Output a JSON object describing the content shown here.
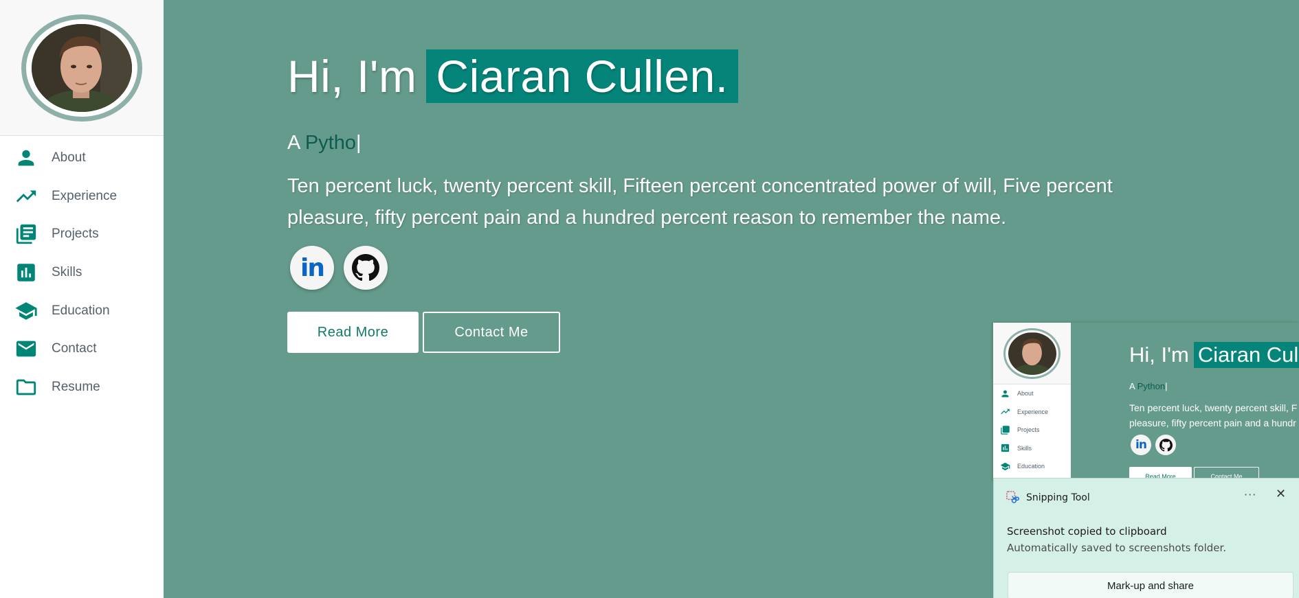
{
  "colors": {
    "accent": "#008577",
    "background": "#659b8c",
    "highlight": "#058579",
    "linkedin": "#0a66c2"
  },
  "sidebar": {
    "avatar_alt": "profile photo",
    "items": [
      {
        "label": "About",
        "icon": "person-icon"
      },
      {
        "label": "Experience",
        "icon": "trending-up-icon"
      },
      {
        "label": "Projects",
        "icon": "library-books-icon"
      },
      {
        "label": "Skills",
        "icon": "bar-chart-icon"
      },
      {
        "label": "Education",
        "icon": "graduation-cap-icon"
      },
      {
        "label": "Contact",
        "icon": "mail-icon"
      },
      {
        "label": "Resume",
        "icon": "folder-icon"
      }
    ]
  },
  "hero": {
    "greeting_prefix": "Hi, I'm",
    "name": "Ciaran Cullen.",
    "typed_prefix": "A",
    "typed_text": "Pytho",
    "cursor": "|",
    "tagline": "Ten percent luck, twenty percent skill, Fifteen percent concentrated power of will, Five percent pleasure, fifty percent pain and a hundred percent reason to remember the name.",
    "linkedin_label": "in",
    "read_more": "Read More",
    "contact_me": "Contact Me"
  },
  "preview": {
    "greeting_prefix": "Hi, I'm",
    "name": "Ciaran Cull",
    "typed_prefix": "A",
    "typed_text": "Python",
    "cursor": "|",
    "tagline_line1": "Ten percent luck, twenty percent skill, F",
    "tagline_line2": "pleasure, fifty percent pain and a hundr",
    "linkedin_label": "in",
    "read_more": "Read More",
    "contact_me": "Contact Me",
    "items": [
      "About",
      "Experience",
      "Projects",
      "Skills",
      "Education"
    ]
  },
  "toast": {
    "app_name": "Snipping Tool",
    "more": "···",
    "close": "✕",
    "title": "Screenshot copied to clipboard",
    "subtitle": "Automatically saved to screenshots folder.",
    "button": "Mark-up and share"
  }
}
